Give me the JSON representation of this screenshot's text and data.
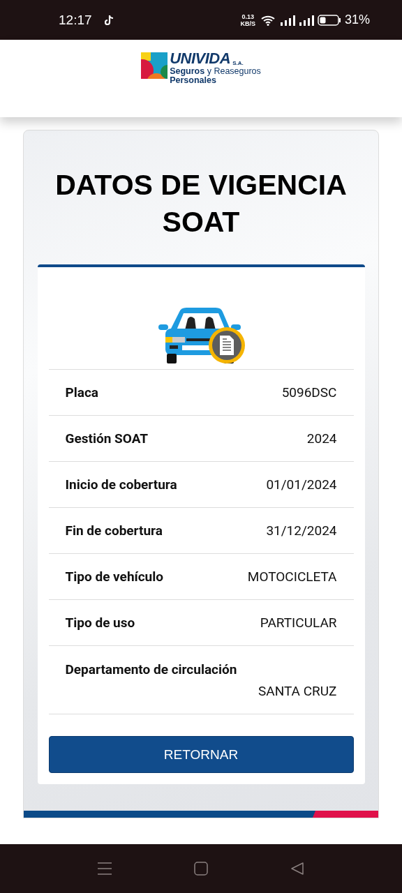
{
  "status_bar": {
    "time": "12:17",
    "net_speed": "0.13",
    "net_unit": "KB/S",
    "battery": "31%"
  },
  "logo": {
    "name": "UNIVIDA",
    "suffix": "S.A.",
    "tagline_bold": "Seguros",
    "tagline": "y Reaseguros",
    "tagline_line2": "Personales"
  },
  "title": "DATOS DE VIGENCIA SOAT",
  "rows": [
    {
      "label": "Placa",
      "value": "5096DSC",
      "kind": "inline"
    },
    {
      "label": "Gestión SOAT",
      "value": "2024",
      "kind": "inline"
    },
    {
      "label": "Inicio de cobertura",
      "value": "01/01/2024",
      "kind": "inline"
    },
    {
      "label": "Fin de cobertura",
      "value": "31/12/2024",
      "kind": "inline"
    },
    {
      "label": "Tipo de vehículo",
      "value": "MOTOCICLETA",
      "kind": "inline"
    },
    {
      "label": "Tipo de uso",
      "value": "PARTICULAR",
      "kind": "inline"
    },
    {
      "label": "Departamento de circulación",
      "value": "SANTA CRUZ",
      "kind": "stacked"
    }
  ],
  "button": "RETORNAR"
}
